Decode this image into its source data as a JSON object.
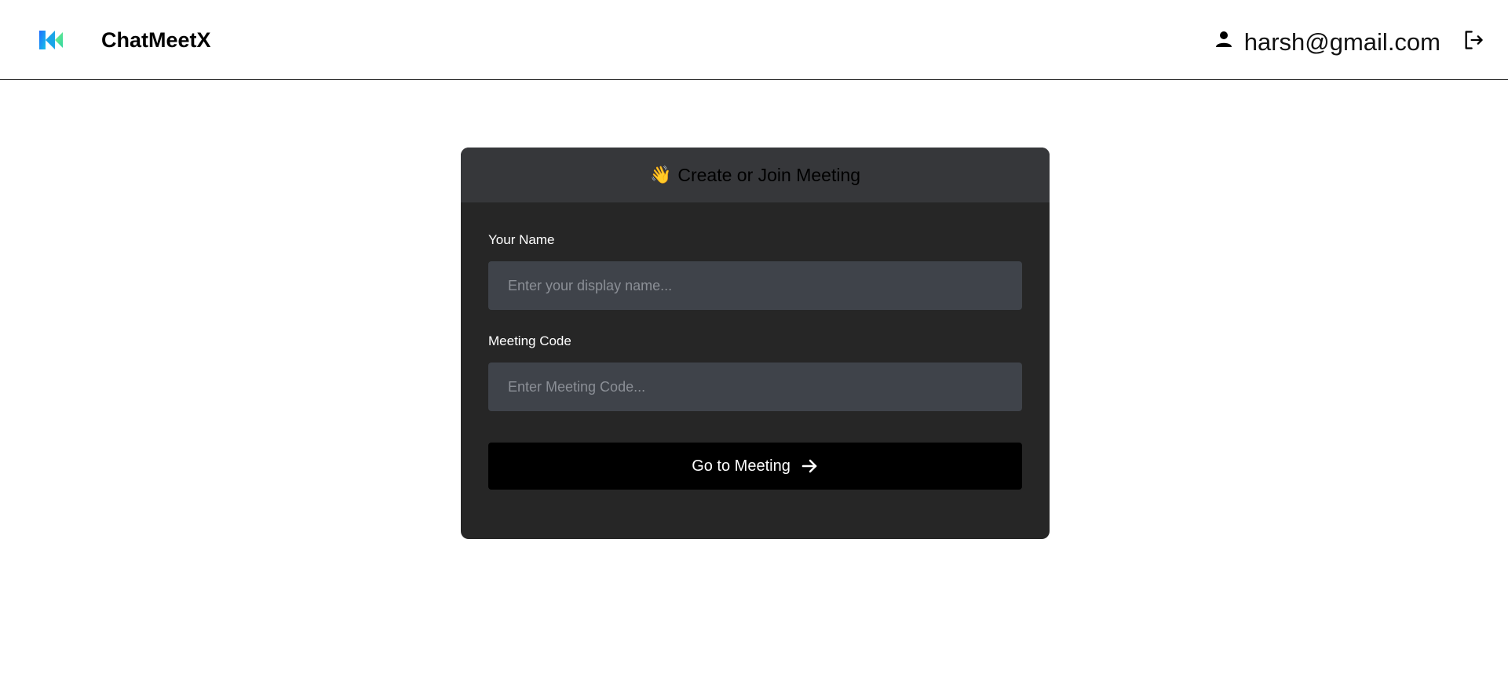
{
  "header": {
    "app_name": "ChatMeetX",
    "logo_icon": "chatmeetx-logo",
    "user_icon": "person-icon",
    "user_email": "harsh@gmail.com",
    "logout_icon": "logout-icon"
  },
  "card": {
    "emoji": "👋",
    "title": "Create or Join Meeting",
    "name_label": "Your Name",
    "name_placeholder": "Enter your display name...",
    "name_value": "",
    "code_label": "Meeting Code",
    "code_placeholder": "Enter Meeting Code...",
    "code_value": "",
    "button_label": "Go to Meeting",
    "button_icon": "arrow-right-icon"
  },
  "colors": {
    "card_bg": "#262626",
    "card_header_bg": "#36373a",
    "input_bg": "#3f434a",
    "button_bg": "#000000"
  }
}
